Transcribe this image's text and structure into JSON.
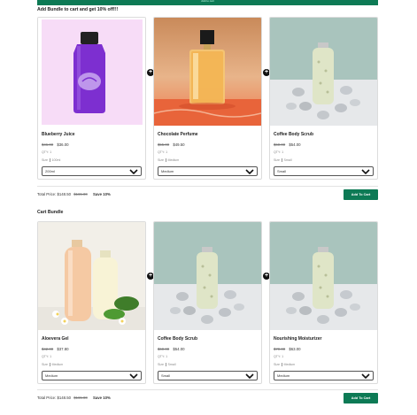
{
  "top_bar": {
    "label": "Add to cart"
  },
  "bundles": [
    {
      "heading": "Add Bundle to cart and get 10% off!!!",
      "products": [
        {
          "title": "Blueberry Juice",
          "old_price": "$46.00",
          "new_price": "$36.00",
          "qty": "QTY: 1",
          "size_label": "Size",
          "size_value": "100ml",
          "selected": "200ml",
          "image": "purple-juice-bottle"
        },
        {
          "title": "Chocolate Perfume",
          "old_price": "$55.00",
          "new_price": "$49.50",
          "qty": "QTY: 1",
          "size_label": "Size",
          "size_value": "Medium",
          "selected": "Medium",
          "image": "perfume-bottle"
        },
        {
          "title": "Coffee Body Scrub",
          "old_price": "$60.00",
          "new_price": "$54.00",
          "qty": "QTY: 1",
          "size_label": "Size",
          "size_value": "Small",
          "selected": "Small",
          "image": "scrub-bottle-stones"
        }
      ],
      "total_label": "Total Price:",
      "total_new": "$148.50",
      "total_old": "$165.00",
      "save_text": "Save 10%",
      "add_button": "Add To Cart"
    },
    {
      "heading": "Cart Bundle",
      "products": [
        {
          "title": "Aloevera Gel",
          "old_price": "$42.00",
          "new_price": "$37.80",
          "qty": "QTY: 1",
          "size_label": "Size",
          "size_value": "Medium",
          "selected": "Medium",
          "image": "aloevera-bottles"
        },
        {
          "title": "Coffee Body Scrub",
          "old_price": "$60.00",
          "new_price": "$54.00",
          "qty": "QTY: 1",
          "size_label": "Size",
          "size_value": "Small",
          "selected": "Small",
          "image": "scrub-bottle-stones"
        },
        {
          "title": "Nourishing Moisturizer",
          "old_price": "$70.00",
          "new_price": "$63.00",
          "qty": "QTY: 1",
          "size_label": "Size",
          "size_value": "Medium",
          "selected": "Medium",
          "image": "scrub-bottle-stones"
        }
      ],
      "total_label": "Total Price:",
      "total_new": "$148.50",
      "total_old": "$165.00",
      "save_text": "Save 10%",
      "add_button": "Add To Cart"
    }
  ],
  "plus_glyph": "+",
  "colors": {
    "accent": "#0d7a55"
  }
}
